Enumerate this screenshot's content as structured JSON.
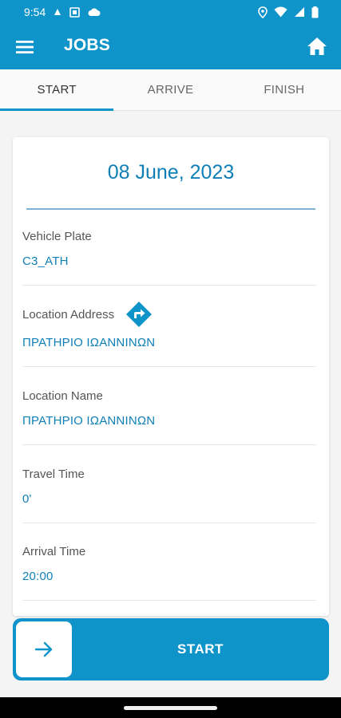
{
  "status_bar": {
    "time": "9:54"
  },
  "app_bar": {
    "title": "JOBS",
    "menu_icon": "hamburger-menu-icon",
    "home_icon": "home-icon"
  },
  "tabs": [
    {
      "label": "START",
      "active": true
    },
    {
      "label": "ARRIVE",
      "active": false
    },
    {
      "label": "FINISH",
      "active": false
    }
  ],
  "job": {
    "date": "08 June, 2023",
    "fields": [
      {
        "label": "Vehicle Plate",
        "value": "C3_ATH"
      },
      {
        "label": "Location Address",
        "value": "ΠΡΑΤΗΡΙΟ ΙΩΑΝΝΙΝΩΝ",
        "icon": "directions-icon"
      },
      {
        "label": "Location Name",
        "value": "ΠΡΑΤΗΡΙΟ ΙΩΑΝΝΙΝΩΝ"
      },
      {
        "label": "Travel Time",
        "value": "0'"
      },
      {
        "label": "Arrival Time",
        "value": "20:00"
      }
    ]
  },
  "action": {
    "label": "START",
    "icon": "arrow-right-icon"
  },
  "colors": {
    "primary": "#0f94c9",
    "value_text": "#0f7fb8"
  }
}
